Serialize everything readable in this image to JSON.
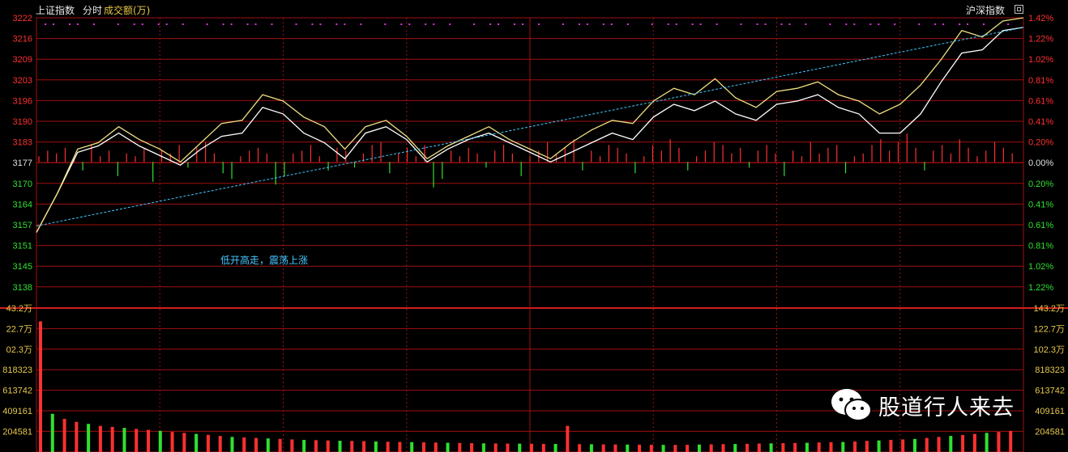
{
  "header": {
    "index_name": "上证指数",
    "mode": "分时",
    "indicator": "成交额(万)",
    "right_label": "沪深指数"
  },
  "annotation": "低开高走，震荡上涨",
  "watermark": {
    "text": "股道行人来去",
    "logo_icon": "wechat-icon"
  },
  "colors": {
    "background": "#000000",
    "grid": "#a01010",
    "up": "#ff3030",
    "down": "#30e030",
    "index_line": "#ffffff",
    "compare_line": "#f0e080",
    "average_line": "#40c8ff",
    "marker_dots": "#e030e0"
  },
  "chart_data": {
    "type": "line",
    "price_axis": {
      "labels": [
        "3222",
        "3216",
        "3209",
        "3203",
        "3196",
        "3190",
        "3183",
        "3177",
        "3170",
        "3164",
        "3157",
        "3151",
        "3145",
        "3138"
      ],
      "ylim": [
        3138,
        3222
      ],
      "base_price": 3177
    },
    "percent_axis": {
      "labels": [
        "1.42%",
        "1.22%",
        "1.02%",
        "0.81%",
        "0.61%",
        "0.41%",
        "0.20%",
        "0.00%",
        "0.20%",
        "0.41%",
        "0.61%",
        "0.81%",
        "1.02%",
        "1.22%"
      ]
    },
    "volume_axis": {
      "left_labels": [
        "43.2万",
        "22.7万",
        "02.3万",
        "818323",
        "613742",
        "409161",
        "204581"
      ],
      "right_labels": [
        "143.2万",
        "122.7万",
        "102.3万",
        "818323",
        "613742",
        "409161",
        "204581"
      ],
      "ylim": [
        0,
        1432000
      ]
    },
    "series": [
      {
        "name": "上证指数",
        "x": [
          0,
          5,
          10,
          15,
          20,
          25,
          30,
          35,
          40,
          45,
          50,
          55,
          60,
          65,
          70,
          75,
          80,
          85,
          90,
          95,
          100,
          105,
          110,
          115,
          120,
          125,
          130,
          135,
          140,
          145,
          150,
          155,
          160,
          165,
          170,
          175,
          180,
          185,
          190,
          195,
          200,
          205,
          210,
          215,
          220,
          225,
          230,
          235,
          240
        ],
        "y": [
          3155,
          3167,
          3180,
          3182,
          3186,
          3182,
          3179,
          3176,
          3181,
          3185,
          3186,
          3194,
          3192,
          3186,
          3183,
          3178,
          3186,
          3188,
          3184,
          3177,
          3181,
          3184,
          3186,
          3183,
          3180,
          3177,
          3180,
          3183,
          3186,
          3184,
          3191,
          3195,
          3193,
          3196,
          3192,
          3190,
          3195,
          3196,
          3198,
          3194,
          3192,
          3186,
          3186,
          3192,
          3202,
          3211,
          3212,
          3218,
          3219
        ]
      },
      {
        "name": "沪深指数",
        "x": [
          0,
          5,
          10,
          15,
          20,
          25,
          30,
          35,
          40,
          45,
          50,
          55,
          60,
          65,
          70,
          75,
          80,
          85,
          90,
          95,
          100,
          105,
          110,
          115,
          120,
          125,
          130,
          135,
          140,
          145,
          150,
          155,
          160,
          165,
          170,
          175,
          180,
          185,
          190,
          195,
          200,
          205,
          210,
          215,
          220,
          225,
          230,
          235,
          240
        ],
        "y": [
          3155,
          3167,
          3181,
          3183,
          3188,
          3184,
          3181,
          3177,
          3183,
          3189,
          3190,
          3198,
          3196,
          3191,
          3188,
          3181,
          3188,
          3190,
          3185,
          3178,
          3182,
          3185,
          3188,
          3184,
          3181,
          3178,
          3183,
          3187,
          3190,
          3189,
          3196,
          3200,
          3198,
          3203,
          3197,
          3194,
          3199,
          3200,
          3202,
          3198,
          3196,
          3192,
          3195,
          3201,
          3209,
          3218,
          3216,
          3221,
          3222
        ]
      },
      {
        "name": "均价",
        "x": [
          0,
          240
        ],
        "y": [
          3157,
          3219
        ]
      }
    ],
    "change_bars": [
      2,
      4,
      3,
      5,
      1,
      -3,
      6,
      2,
      4,
      -5,
      3,
      2,
      5,
      -7,
      4,
      3,
      6,
      -2,
      5,
      7,
      3,
      -4,
      -6,
      2,
      4,
      5,
      3,
      -8,
      -5,
      3,
      4,
      6,
      2,
      -3,
      5,
      4,
      -2,
      3,
      6,
      7,
      -4,
      3,
      5,
      2,
      6,
      -9,
      -6,
      4,
      2,
      5,
      3,
      -2,
      4,
      6,
      3,
      -5,
      2,
      4,
      7,
      3,
      5,
      8,
      -3,
      4,
      2,
      6,
      5,
      3,
      -4,
      2,
      6,
      4,
      8,
      5,
      -3,
      2,
      4,
      7,
      6,
      3,
      5,
      -2,
      4,
      6,
      3,
      -5,
      4,
      2,
      7,
      3,
      5,
      6,
      -4,
      2,
      3,
      6,
      8,
      4,
      7,
      10,
      5,
      -3,
      4,
      6,
      3,
      8,
      5,
      2,
      4,
      7,
      5,
      3
    ],
    "volume": [
      1300000,
      380000,
      330000,
      300000,
      280000,
      260000,
      250000,
      240000,
      230000,
      220000,
      210000,
      200000,
      190000,
      180000,
      170000,
      160000,
      150000,
      145000,
      140000,
      135000,
      130000,
      125000,
      120000,
      118000,
      115000,
      112000,
      110000,
      108000,
      105000,
      102000,
      100000,
      98000,
      96000,
      94000,
      92000,
      90000,
      88000,
      86000,
      85000,
      84000,
      83000,
      82000,
      81000,
      80000,
      260000,
      78000,
      77000,
      76000,
      75000,
      74000,
      73000,
      72000,
      71000,
      70000,
      72000,
      74000,
      76000,
      78000,
      80000,
      82000,
      84000,
      86000,
      88000,
      90000,
      92000,
      95000,
      98000,
      100000,
      105000,
      110000,
      115000,
      120000,
      125000,
      130000,
      140000,
      150000,
      160000,
      170000,
      180000,
      190000,
      200000,
      210000
    ]
  }
}
